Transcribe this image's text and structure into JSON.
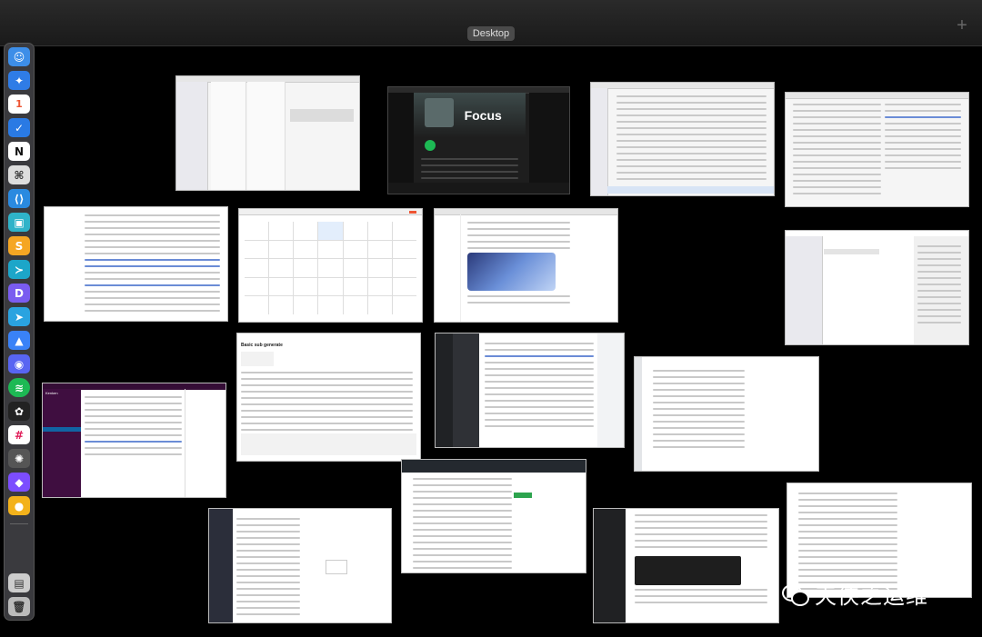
{
  "space_bar": {
    "desktop_label": "Desktop",
    "add_label": "+"
  },
  "windows": {
    "spotify": {
      "title": "Focus"
    },
    "slack": {
      "title": "Kenken"
    },
    "markdown": {
      "title": "Basic sub generate"
    }
  },
  "watermark": {
    "text": "天侠之运维"
  }
}
